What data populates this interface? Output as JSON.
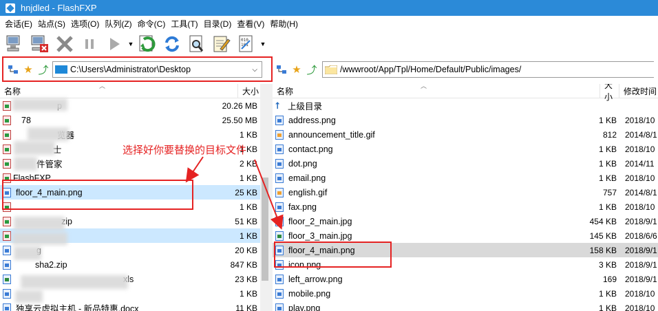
{
  "window": {
    "title": "hnjdled - FlashFXP"
  },
  "menu": [
    {
      "label": "会话(E)"
    },
    {
      "label": "站点(S)"
    },
    {
      "label": "选项(O)"
    },
    {
      "label": "队列(Z)"
    },
    {
      "label": "命令(C)"
    },
    {
      "label": "工具(T)"
    },
    {
      "label": "目录(D)"
    },
    {
      "label": "查看(V)"
    },
    {
      "label": "帮助(H)"
    }
  ],
  "toolbar": {
    "icons": [
      "connect-icon",
      "disconnect-icon",
      "abort-icon",
      "pause-icon",
      "play-icon",
      "transfer-icon",
      "refresh-icon",
      "view-icon",
      "edit-icon",
      "binary-mode-icon"
    ]
  },
  "left_path": "C:\\Users\\Administrator\\Desktop",
  "right_path": "/wwwroot/App/Tpl/Home/Default/Public/images/",
  "left_headers": {
    "name": "名称",
    "size": "大小"
  },
  "right_headers": {
    "name": "名称",
    "size": "大小",
    "date": "修改时间"
  },
  "left_files": [
    {
      "name": "p",
      "size": "20.26 MB"
    },
    {
      "name": "78",
      "size": "25.50 MB"
    },
    {
      "name": "览器",
      "size": "1 KB"
    },
    {
      "name": "士",
      "size": "1 KB"
    },
    {
      "name": "件管家",
      "size": "2 KB"
    },
    {
      "name": "FlashFXP",
      "size": "1 KB"
    },
    {
      "name": "floor_4_main.png",
      "size": "25 KB"
    },
    {
      "name": "",
      "size": "1 KB"
    },
    {
      "name": "zip",
      "size": "51 KB"
    },
    {
      "name": "",
      "size": "1 KB"
    },
    {
      "name": "g",
      "size": "20 KB"
    },
    {
      "name": "sha2.zip",
      "size": "847 KB"
    },
    {
      "name": "xls",
      "size": "23 KB"
    },
    {
      "name": "",
      "size": "1 KB"
    },
    {
      "name": "独享云虚拟主机 - 新品特惠.docx",
      "size": "11 KB"
    }
  ],
  "right_files": [
    {
      "name": "上级目录",
      "size": "",
      "date": ""
    },
    {
      "name": "address.png",
      "size": "1 KB",
      "date": "2018/10"
    },
    {
      "name": "announcement_title.gif",
      "size": "812",
      "date": "2014/8/1"
    },
    {
      "name": "contact.png",
      "size": "1 KB",
      "date": "2018/10"
    },
    {
      "name": "dot.png",
      "size": "1 KB",
      "date": "2014/11"
    },
    {
      "name": "email.png",
      "size": "1 KB",
      "date": "2018/10"
    },
    {
      "name": "english.gif",
      "size": "757",
      "date": "2014/8/1"
    },
    {
      "name": "fax.png",
      "size": "1 KB",
      "date": "2018/10"
    },
    {
      "name": "floor_2_main.jpg",
      "size": "454 KB",
      "date": "2018/9/1"
    },
    {
      "name": "floor_3_main.jpg",
      "size": "145 KB",
      "date": "2018/6/6"
    },
    {
      "name": "floor_4_main.png",
      "size": "158 KB",
      "date": "2018/9/1"
    },
    {
      "name": "icon.png",
      "size": "3 KB",
      "date": "2018/9/1"
    },
    {
      "name": "left_arrow.png",
      "size": "169",
      "date": "2018/9/1"
    },
    {
      "name": "mobile.png",
      "size": "1 KB",
      "date": "2018/10"
    },
    {
      "name": "play.png",
      "size": "1 KB",
      "date": "2018/10"
    }
  ],
  "annotation": {
    "text": "选择好你要替换的目标文件"
  }
}
